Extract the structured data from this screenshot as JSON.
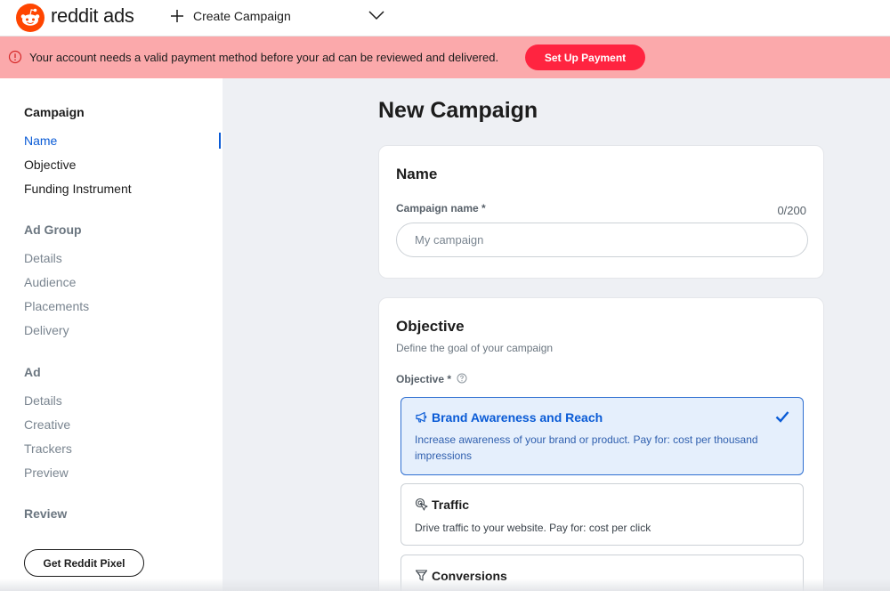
{
  "topbar": {
    "brand": "reddit ads",
    "create_label": "Create Campaign"
  },
  "banner": {
    "message": "Your account needs a valid payment method before your ad can be reviewed and delivered.",
    "button": "Set Up Payment"
  },
  "sidebar": {
    "campaign": {
      "title": "Campaign",
      "items": [
        "Name",
        "Objective",
        "Funding Instrument"
      ]
    },
    "ad_group": {
      "title": "Ad Group",
      "items": [
        "Details",
        "Audience",
        "Placements",
        "Delivery"
      ]
    },
    "ad": {
      "title": "Ad",
      "items": [
        "Details",
        "Creative",
        "Trackers",
        "Preview"
      ]
    },
    "review": {
      "title": "Review"
    },
    "pixel_button": "Get Reddit Pixel"
  },
  "main": {
    "page_title": "New Campaign",
    "name_card": {
      "title": "Name",
      "label": "Campaign name *",
      "counter": "0/200",
      "placeholder": "My campaign",
      "value": ""
    },
    "objective_card": {
      "title": "Objective",
      "subtitle": "Define the goal of your campaign",
      "label": "Objective *",
      "options": [
        {
          "icon": "megaphone-icon",
          "title": "Brand Awareness and Reach",
          "desc": "Increase awareness of your brand or product. Pay for: cost per thousand impressions",
          "selected": true
        },
        {
          "icon": "cursor-click-icon",
          "title": "Traffic",
          "desc": "Drive traffic to your website. Pay for: cost per click",
          "selected": false
        },
        {
          "icon": "funnel-icon",
          "title": "Conversions",
          "desc": "",
          "selected": false
        }
      ]
    }
  },
  "colors": {
    "accent": "#0a5bd6",
    "banner_bg": "#fba9ab",
    "payment_button": "#ff2440",
    "reddit_orange": "#ff4500"
  }
}
